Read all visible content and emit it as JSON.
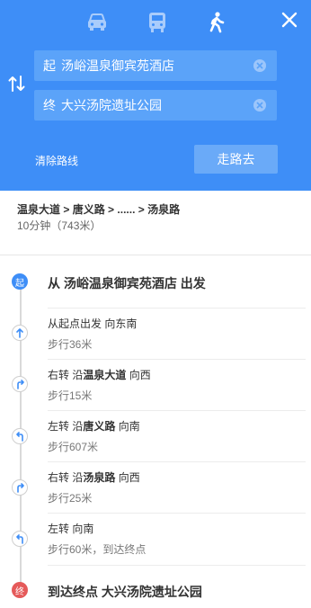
{
  "header": {
    "modes": [
      {
        "name": "car-icon",
        "selected": false
      },
      {
        "name": "bus-icon",
        "selected": false
      },
      {
        "name": "walk-icon",
        "selected": true
      }
    ],
    "colors": {
      "primary": "#3e8ef7",
      "input_bg": "#5ba3f9",
      "button_bg": "#6aaaf8"
    }
  },
  "origin": {
    "tag": "起",
    "value": "汤峪温泉御宾苑酒店"
  },
  "destination": {
    "tag": "终",
    "value": "大兴汤院遗址公园"
  },
  "actions": {
    "clear_route": "清除路线",
    "go": "走路去"
  },
  "summary": {
    "path_parts": [
      "温泉大道",
      "唐义路",
      "......",
      "汤泉路"
    ],
    "separator": " > ",
    "time": "10分钟（743米）"
  },
  "start": {
    "badge": "起",
    "title": "从 汤峪温泉御宾苑酒店 出发"
  },
  "steps": [
    {
      "icon": "straight-arrow-icon",
      "pre": "从起点出发 向东南",
      "road": "",
      "post": "",
      "detail": "步行36米"
    },
    {
      "icon": "turn-right-icon",
      "pre": "右转 沿",
      "road": "温泉大道",
      "post": " 向西",
      "detail": "步行15米"
    },
    {
      "icon": "turn-left-icon",
      "pre": "左转 沿",
      "road": "唐义路",
      "post": " 向南",
      "detail": "步行607米"
    },
    {
      "icon": "turn-right-icon",
      "pre": "右转 沿",
      "road": "汤泉路",
      "post": " 向西",
      "detail": "步行25米"
    },
    {
      "icon": "turn-left-icon",
      "pre": "左转 向南",
      "road": "",
      "post": "",
      "detail": "步行60米，到达终点"
    }
  ],
  "end": {
    "badge": "终",
    "title": "到达终点 大兴汤院遗址公园"
  }
}
